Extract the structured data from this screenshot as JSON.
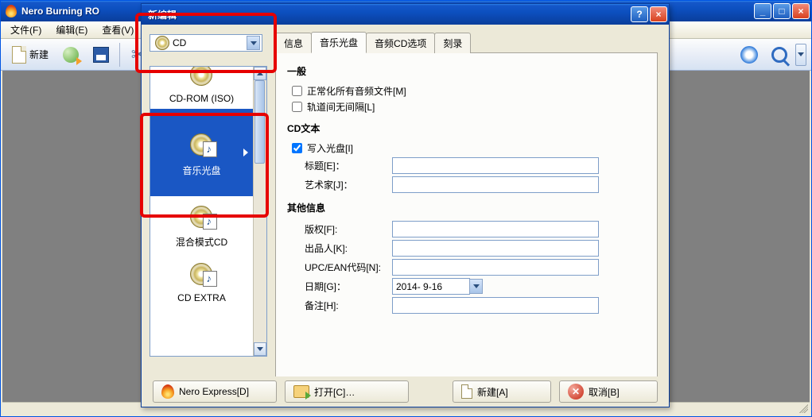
{
  "main_window": {
    "title": "Nero Burning RO",
    "menu": {
      "file": "文件(F)",
      "edit": "编辑(E)",
      "view": "查看(V)"
    },
    "toolbar": {
      "new_label": "新建"
    }
  },
  "dialog": {
    "title": "新编辑",
    "disc_type_selected": "CD",
    "types": {
      "cdrom_iso": "CD-ROM (ISO)",
      "audio_cd": "音乐光盘",
      "mixed_mode": "混合模式CD",
      "cd_extra": "CD EXTRA"
    },
    "tabs": {
      "info": "信息",
      "audio_cd": "音乐光盘",
      "audio_cd_options": "音频CD选项",
      "burn": "刻录"
    },
    "general": {
      "heading": "一般",
      "normalize": "正常化所有音频文件[M]",
      "no_gap": "轨道间无间隔[L]"
    },
    "cd_text": {
      "heading": "CD文本",
      "write_cd": "写入光盘[I]",
      "title_label": "标题[E]：",
      "artist_label": "艺术家[J]：",
      "title_value": "",
      "artist_value": ""
    },
    "other": {
      "heading": "其他信息",
      "copyright_label": "版权[F]:",
      "producer_label": "出品人[K]:",
      "upc_label": "UPC/EAN代码[N]:",
      "date_label": "日期[G]：",
      "notes_label": "备注[H]:",
      "copyright_value": "",
      "producer_value": "",
      "upc_value": "",
      "date_value": "2014- 9-16",
      "notes_value": ""
    },
    "buttons": {
      "nero_express": "Nero Express[D]",
      "open": "打开[C]…",
      "new": "新建[A]",
      "cancel": "取消[B]"
    }
  }
}
